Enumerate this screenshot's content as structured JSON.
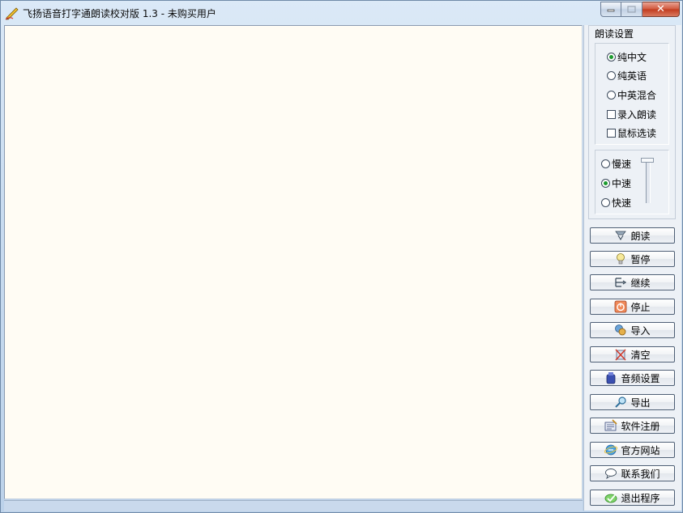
{
  "window": {
    "title": "飞扬语音打字通朗读校对版 1.3 - 未购买用户",
    "close_glyph": "✕"
  },
  "editor": {
    "text": ""
  },
  "settings": {
    "group_title": "朗读设置",
    "mode_options": [
      {
        "label": "纯中文",
        "checked": true
      },
      {
        "label": "纯英语",
        "checked": false
      },
      {
        "label": "中英混合",
        "checked": false
      }
    ],
    "checkboxes": [
      {
        "label": "录入朗读",
        "checked": false
      },
      {
        "label": "鼠标选读",
        "checked": false
      }
    ],
    "speed_options": [
      {
        "label": "慢速",
        "checked": false
      },
      {
        "label": "中速",
        "checked": true
      },
      {
        "label": "快速",
        "checked": false
      }
    ]
  },
  "buttons": [
    {
      "label": "朗读",
      "icon": "speaker-icon"
    },
    {
      "label": "暂停",
      "icon": "lightbulb-icon"
    },
    {
      "label": "继续",
      "icon": "continue-arrow-icon"
    },
    {
      "label": "停止",
      "icon": "power-icon"
    },
    {
      "label": "导入",
      "icon": "import-icon"
    },
    {
      "label": "清空",
      "icon": "clear-icon"
    },
    {
      "label": "音频设置",
      "icon": "audio-icon"
    },
    {
      "label": "导出",
      "icon": "magnifier-icon"
    },
    {
      "label": "软件注册",
      "icon": "register-icon"
    },
    {
      "label": "官方网站",
      "icon": "browser-icon"
    },
    {
      "label": "联系我们",
      "icon": "chat-bubble-icon"
    },
    {
      "label": "退出程序",
      "icon": "exit-check-icon"
    }
  ],
  "colors": {
    "editor_bg": "#fffcf4",
    "radio_dot": "#1b9a2e",
    "close_button": "#c23c1f"
  }
}
